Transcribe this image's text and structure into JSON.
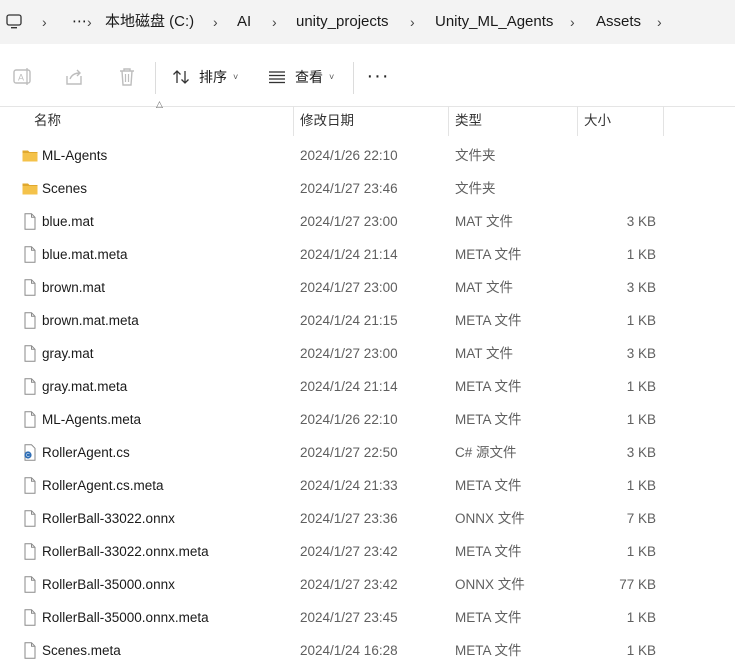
{
  "breadcrumb": {
    "more": "⋯",
    "items": [
      "本地磁盘 (C:)",
      "AI",
      "unity_projects",
      "Unity_ML_Agents",
      "Assets"
    ],
    "separator": "›"
  },
  "toolbar": {
    "sort_label": "排序",
    "view_label": "查看",
    "more_label": "···",
    "caret": "˅"
  },
  "columns": {
    "name": "名称",
    "date": "修改日期",
    "type": "类型",
    "size": "大小"
  },
  "files": [
    {
      "icon": "folder",
      "name": "ML-Agents",
      "date": "2024/1/26 22:10",
      "type": "文件夹",
      "size": ""
    },
    {
      "icon": "folder",
      "name": "Scenes",
      "date": "2024/1/27 23:46",
      "type": "文件夹",
      "size": ""
    },
    {
      "icon": "file",
      "name": "blue.mat",
      "date": "2024/1/27 23:00",
      "type": "MAT 文件",
      "size": "3 KB"
    },
    {
      "icon": "file",
      "name": "blue.mat.meta",
      "date": "2024/1/24 21:14",
      "type": "META 文件",
      "size": "1 KB"
    },
    {
      "icon": "file",
      "name": "brown.mat",
      "date": "2024/1/27 23:00",
      "type": "MAT 文件",
      "size": "3 KB"
    },
    {
      "icon": "file",
      "name": "brown.mat.meta",
      "date": "2024/1/24 21:15",
      "type": "META 文件",
      "size": "1 KB"
    },
    {
      "icon": "file",
      "name": "gray.mat",
      "date": "2024/1/27 23:00",
      "type": "MAT 文件",
      "size": "3 KB"
    },
    {
      "icon": "file",
      "name": "gray.mat.meta",
      "date": "2024/1/24 21:14",
      "type": "META 文件",
      "size": "1 KB"
    },
    {
      "icon": "file",
      "name": "ML-Agents.meta",
      "date": "2024/1/26 22:10",
      "type": "META 文件",
      "size": "1 KB"
    },
    {
      "icon": "csharp",
      "name": "RollerAgent.cs",
      "date": "2024/1/27 22:50",
      "type": "C# 源文件",
      "size": "3 KB"
    },
    {
      "icon": "file",
      "name": "RollerAgent.cs.meta",
      "date": "2024/1/24 21:33",
      "type": "META 文件",
      "size": "1 KB"
    },
    {
      "icon": "file",
      "name": "RollerBall-33022.onnx",
      "date": "2024/1/27 23:36",
      "type": "ONNX 文件",
      "size": "7 KB"
    },
    {
      "icon": "file",
      "name": "RollerBall-33022.onnx.meta",
      "date": "2024/1/27 23:42",
      "type": "META 文件",
      "size": "1 KB"
    },
    {
      "icon": "file",
      "name": "RollerBall-35000.onnx",
      "date": "2024/1/27 23:42",
      "type": "ONNX 文件",
      "size": "77 KB"
    },
    {
      "icon": "file",
      "name": "RollerBall-35000.onnx.meta",
      "date": "2024/1/27 23:45",
      "type": "META 文件",
      "size": "1 KB"
    },
    {
      "icon": "file",
      "name": "Scenes.meta",
      "date": "2024/1/24 16:28",
      "type": "META 文件",
      "size": "1 KB"
    }
  ],
  "colors": {
    "folder": "#f4c24a",
    "folder_dark": "#e0a82e",
    "file_outline": "#8a8a8a",
    "csharp": "#2d6db5"
  }
}
